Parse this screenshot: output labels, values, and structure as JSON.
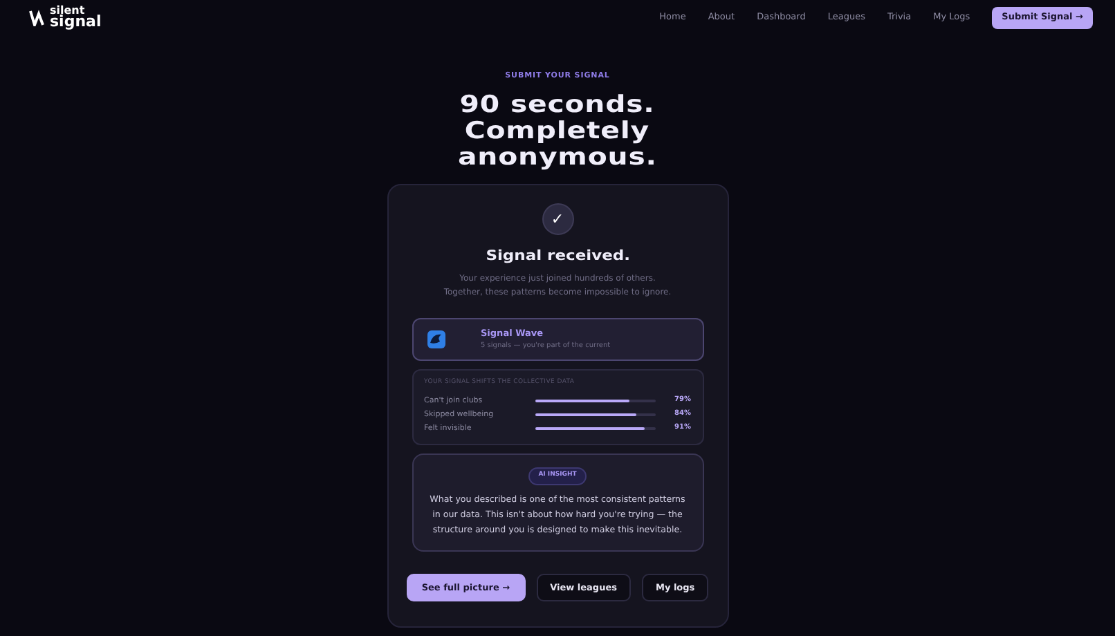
{
  "logo": {
    "line_1": "silent",
    "line_2": "signal"
  },
  "nav": {
    "links": [
      "Home",
      "About",
      "Dashboard",
      "Leagues",
      "Trivia",
      "My Logs"
    ],
    "cta": "Submit Signal →"
  },
  "eyebrow": "SUBMIT YOUR SIGNAL",
  "title": [
    "90 seconds.",
    "Completely",
    "anonymous."
  ],
  "result": {
    "check": "✓",
    "heading": "Signal received.",
    "lines": [
      "Your experience just joined hundreds of others.",
      "Together, these patterns become impossible to ignore."
    ],
    "wave": {
      "name": "Signal Wave",
      "detail": "5 signals — you're part of the current"
    },
    "shifts": {
      "title": "YOUR SIGNAL SHIFTS THE COLLECTIVE DATA",
      "rows": [
        {
          "label": "Can't join clubs",
          "level": 0.79,
          "reading": "79%"
        },
        {
          "label": "Skipped wellbeing",
          "level": 0.84,
          "reading": "84%"
        },
        {
          "label": "Felt invisible",
          "level": 0.91,
          "reading": "91%"
        }
      ]
    },
    "insight": {
      "badge": "AI INSIGHT",
      "text": "What you described is one of the most consistent patterns in our data. This isn't about how hard you're trying — the structure around you is designed to make this inevitable."
    },
    "buttons": [
      {
        "label": "See full picture →",
        "kind": "primary"
      },
      {
        "label": "View leagues",
        "kind": "outline"
      },
      {
        "label": "My logs",
        "kind": "outline"
      }
    ]
  }
}
